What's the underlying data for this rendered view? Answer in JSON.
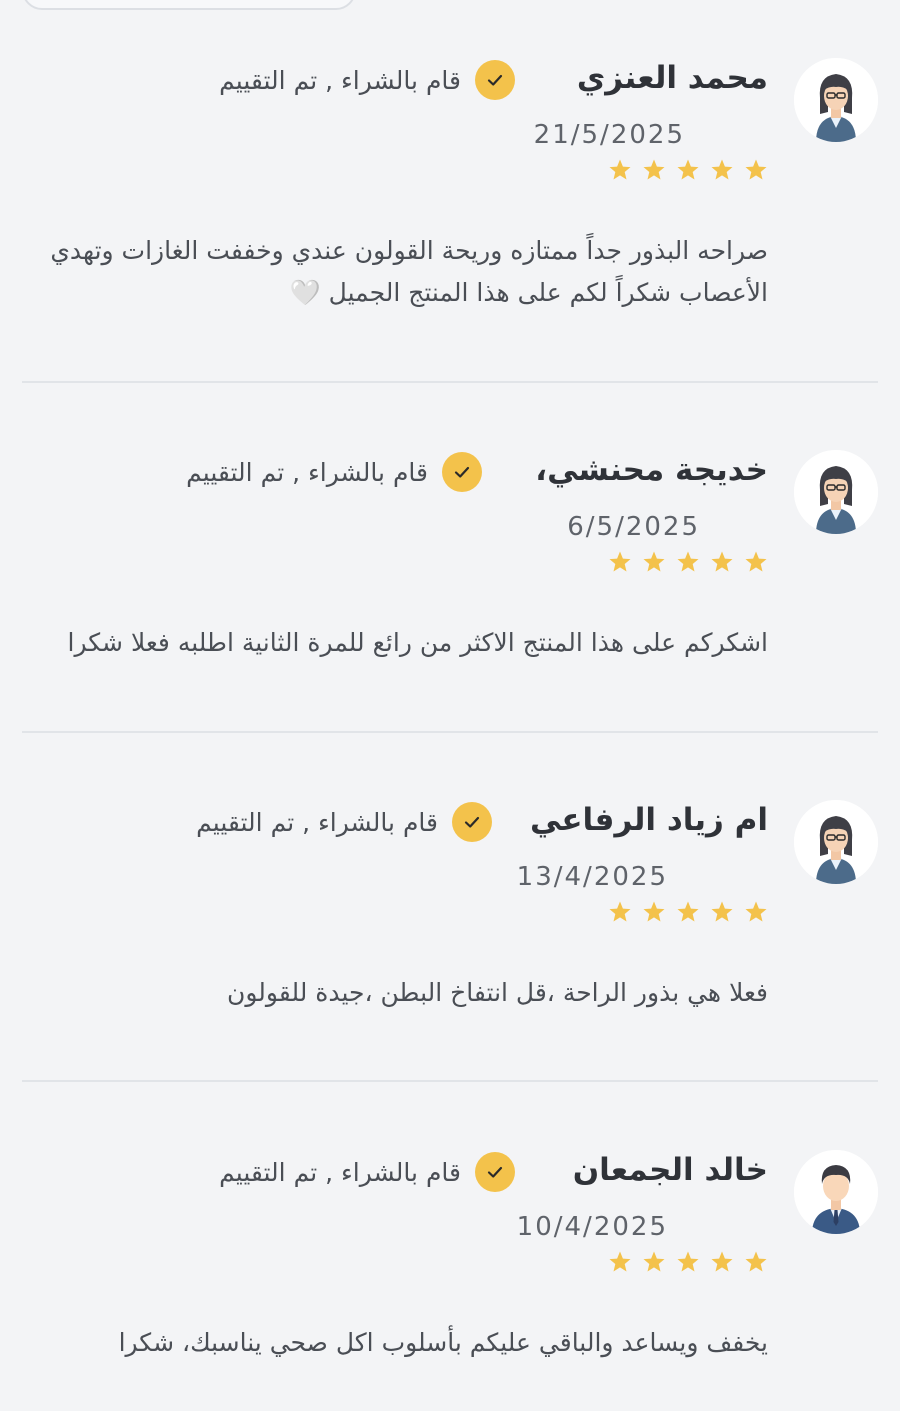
{
  "reviews": [
    {
      "name": "محمد العنزي",
      "verified_label": "قام بالشراء , تم التقييم",
      "date": "21/5/2025",
      "stars": 5,
      "comment": "صراحه البذور جداً ممتازه وريحة القولون عندي وخففت الغازات وتهدي الأعصاب شكراً لكم على هذا المنتج الجميل 🤍",
      "avatar": "female-avatar-icon"
    },
    {
      "name": "خديجة محنشي،",
      "verified_label": "قام بالشراء , تم التقييم",
      "date": "6/5/2025",
      "stars": 5,
      "comment": "اشكركم على هذا المنتج الاكثر من رائع للمرة الثانية اطلبه فعلا شكرا",
      "avatar": "female-avatar-icon"
    },
    {
      "name": "ام زياد الرفاعي",
      "verified_label": "قام بالشراء , تم التقييم",
      "date": "13/4/2025",
      "stars": 5,
      "comment": "فعلا هي بذور الراحة ،قل انتفاخ البطن ،جيدة للقولون",
      "avatar": "female-avatar-icon"
    },
    {
      "name": "خالد الجمعان",
      "verified_label": "قام بالشراء , تم التقييم",
      "date": "10/4/2025",
      "stars": 5,
      "comment": "يخفف ويساعد والباقي عليكم بأسلوب اكل صحي يناسبك، شكرا",
      "avatar": "male-avatar-icon"
    }
  ],
  "colors": {
    "star": "#f3c24b",
    "check_badge": "#f3c24b",
    "background": "#f3f4f6"
  }
}
